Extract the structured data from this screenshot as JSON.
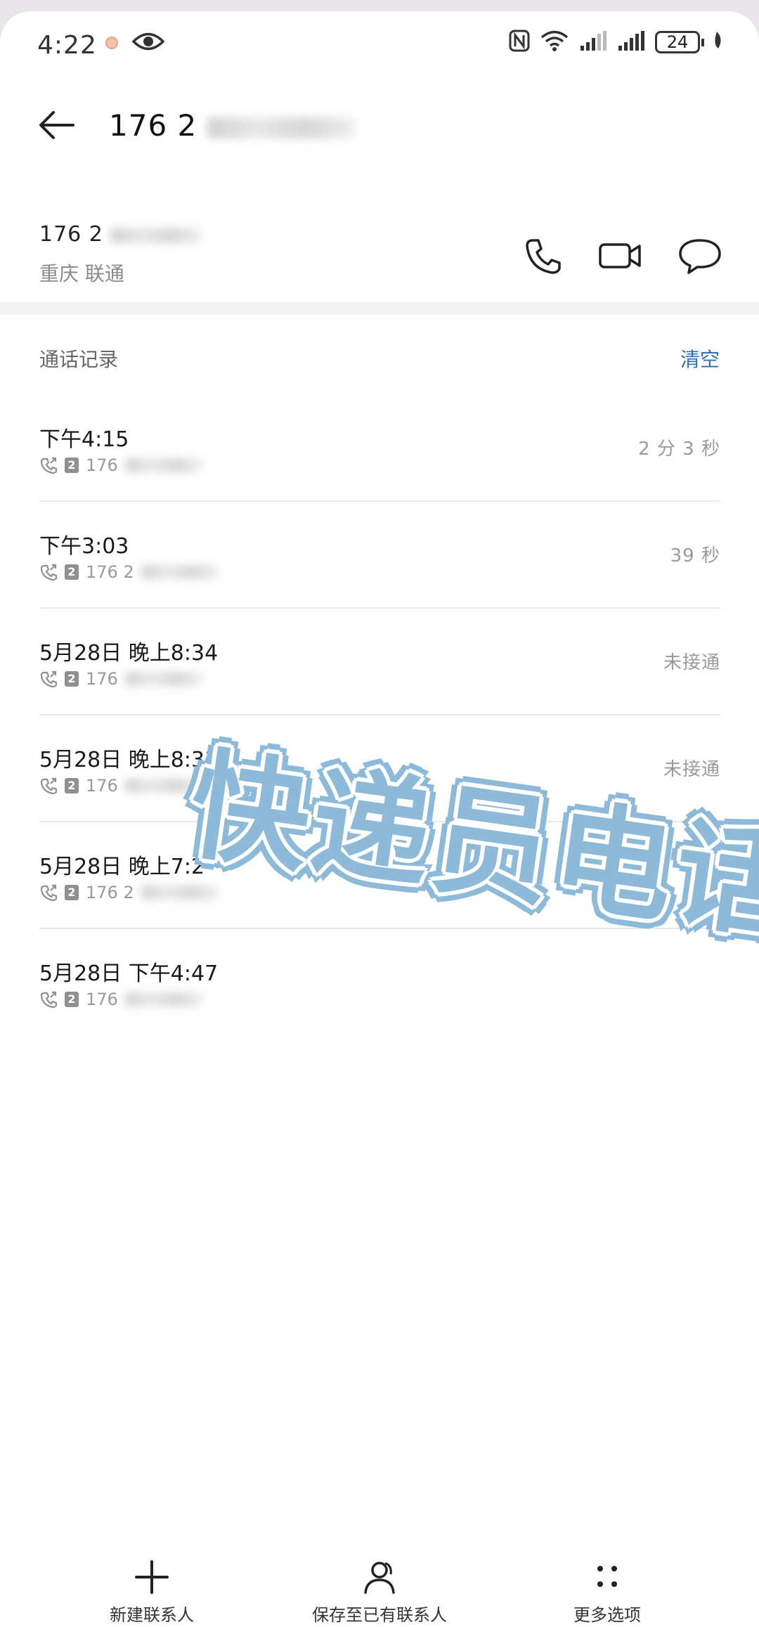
{
  "status": {
    "time": "4:22",
    "battery": "24"
  },
  "header": {
    "title_prefix": "176 2"
  },
  "contact": {
    "number_prefix": "176 2",
    "location": "重庆 联通"
  },
  "call_log": {
    "section_title": "通话记录",
    "clear_label": "清空",
    "entries": [
      {
        "when": "下午4:15",
        "sim": "2",
        "number_prefix": "176",
        "duration": "2 分 3 秒"
      },
      {
        "when": "下午3:03",
        "sim": "2",
        "number_prefix": "176 2",
        "duration": "39 秒"
      },
      {
        "when": "5月28日 晚上8:34",
        "sim": "2",
        "number_prefix": "176",
        "duration": "未接通"
      },
      {
        "when": "5月28日 晚上8:33",
        "sim": "2",
        "number_prefix": "176",
        "duration": "未接通"
      },
      {
        "when": "5月28日 晚上7:2",
        "sim": "2",
        "number_prefix": "176 2",
        "duration": ""
      },
      {
        "when": "5月28日 下午4:47",
        "sim": "2",
        "number_prefix": "176",
        "duration": ""
      }
    ]
  },
  "watermark": "快递员电话",
  "bottom_bar": {
    "new_contact": "新建联系人",
    "save_existing": "保存至已有联系人",
    "more_options": "更多选项"
  },
  "colors": {
    "accent": "#2a6fb0",
    "watermark": "#8cbad8"
  }
}
